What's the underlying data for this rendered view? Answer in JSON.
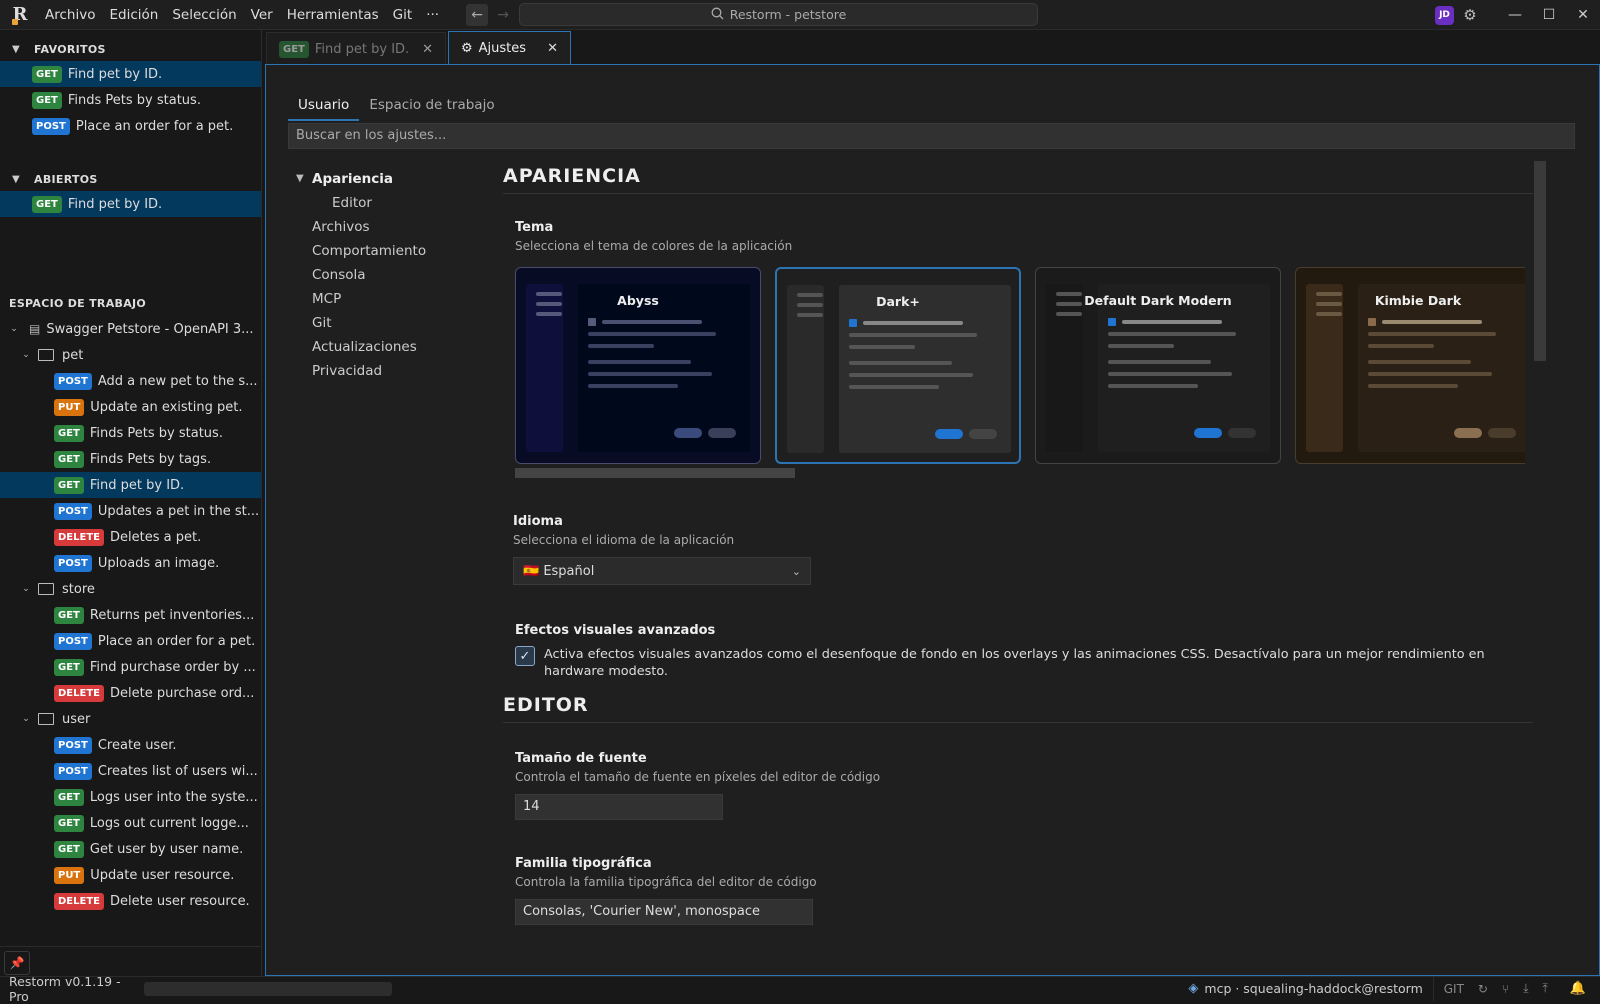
{
  "titlebar": {
    "menu": [
      "Archivo",
      "Edición",
      "Selección",
      "Ver",
      "Herramientas",
      "Git",
      "···"
    ],
    "search": "Restorm - petstore",
    "avatar": "JD"
  },
  "sidebar": {
    "favorites": {
      "title": "FAVORITOS",
      "items": [
        {
          "method": "GET",
          "label": "Find pet by ID."
        },
        {
          "method": "GET",
          "label": "Finds Pets by status."
        },
        {
          "method": "POST",
          "label": "Place an order for a pet."
        }
      ]
    },
    "open": {
      "title": "ABIERTOS",
      "items": [
        {
          "method": "GET",
          "label": "Find pet by ID."
        }
      ]
    },
    "workspace": {
      "title": "ESPACIO DE TRABAJO",
      "root": "Swagger Petstore - OpenAPI 3...",
      "folders": [
        {
          "name": "pet",
          "items": [
            {
              "method": "POST",
              "label": "Add a new pet to the s..."
            },
            {
              "method": "PUT",
              "label": "Update an existing pet."
            },
            {
              "method": "GET",
              "label": "Finds Pets by status."
            },
            {
              "method": "GET",
              "label": "Finds Pets by tags."
            },
            {
              "method": "GET",
              "label": "Find pet by ID."
            },
            {
              "method": "POST",
              "label": "Updates a pet in the st..."
            },
            {
              "method": "DELETE",
              "label": "Deletes a pet."
            },
            {
              "method": "POST",
              "label": "Uploads an image."
            }
          ]
        },
        {
          "name": "store",
          "items": [
            {
              "method": "GET",
              "label": "Returns pet inventories..."
            },
            {
              "method": "POST",
              "label": "Place an order for a pet."
            },
            {
              "method": "GET",
              "label": "Find purchase order by ..."
            },
            {
              "method": "DELETE",
              "label": "Delete purchase ord..."
            }
          ]
        },
        {
          "name": "user",
          "items": [
            {
              "method": "POST",
              "label": "Create user."
            },
            {
              "method": "POST",
              "label": "Creates list of users wi..."
            },
            {
              "method": "GET",
              "label": "Logs user into the syste..."
            },
            {
              "method": "GET",
              "label": "Logs out current logge..."
            },
            {
              "method": "GET",
              "label": "Get user by user name."
            },
            {
              "method": "PUT",
              "label": "Update user resource."
            },
            {
              "method": "DELETE",
              "label": "Delete user resource."
            }
          ]
        }
      ]
    }
  },
  "tabs": [
    {
      "method": "GET",
      "label": "Find pet by ID.",
      "active": false
    },
    {
      "label": "Ajustes",
      "active": true
    }
  ],
  "settings": {
    "subtabs": [
      "Usuario",
      "Espacio de trabajo"
    ],
    "search_placeholder": "Buscar en los ajustes...",
    "nav": [
      "Apariencia",
      "Editor",
      "Archivos",
      "Comportamiento",
      "Consola",
      "MCP",
      "Git",
      "Actualizaciones",
      "Privacidad"
    ],
    "appearance_title": "APARIENCIA",
    "theme": {
      "label": "Tema",
      "desc": "Selecciona el tema de colores de la aplicación",
      "options": [
        "Abyss",
        "Dark+",
        "Default Dark Modern",
        "Kimbie Dark"
      ],
      "selected": "Dark+"
    },
    "language": {
      "label": "Idioma",
      "desc": "Selecciona el idioma de la aplicación",
      "value": "🇪🇸 Español"
    },
    "effects": {
      "label": "Efectos visuales avanzados",
      "desc": "Activa efectos visuales avanzados como el desenfoque de fondo en los overlays y las animaciones CSS. Desactívalo para un mejor rendimiento en hardware modesto.",
      "checked": true
    },
    "editor_title": "EDITOR",
    "font_size": {
      "label": "Tamaño de fuente",
      "desc": "Controla el tamaño de fuente en píxeles del editor de código",
      "value": "14"
    },
    "font_family": {
      "label": "Familia tipográfica",
      "desc": "Controla la familia tipográfica del editor de código",
      "value": "Consolas, 'Courier New', monospace"
    }
  },
  "statusbar": {
    "version": "Restorm v0.1.19 - Pro",
    "mcp": "mcp · squealing-haddock@restorm",
    "git": "GIT"
  }
}
